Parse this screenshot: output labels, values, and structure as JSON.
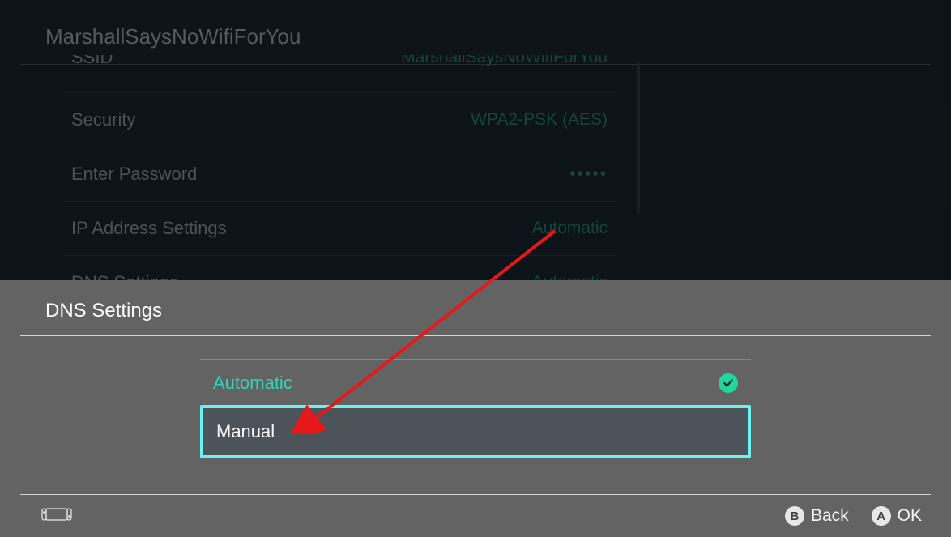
{
  "network_name": "MarshallSaysNoWifiForYou",
  "background_rows": [
    {
      "label": "SSID",
      "value": "MarshallSaysNoWifiForYou",
      "truncated": true
    },
    {
      "label": "Security",
      "value": "WPA2-PSK (AES)"
    },
    {
      "label": "Enter Password",
      "value": "•••••",
      "dots": true
    },
    {
      "label": "IP Address Settings",
      "value": "Automatic"
    },
    {
      "label": "DNS Settings",
      "value": "Automatic",
      "truncated_bottom": true
    }
  ],
  "overlay": {
    "title": "DNS Settings",
    "options": [
      {
        "label": "Automatic",
        "selected": true,
        "highlighted": false
      },
      {
        "label": "Manual",
        "selected": false,
        "highlighted": true
      }
    ]
  },
  "hints": {
    "back": {
      "button": "B",
      "label": "Back"
    },
    "ok": {
      "button": "A",
      "label": "OK"
    }
  }
}
